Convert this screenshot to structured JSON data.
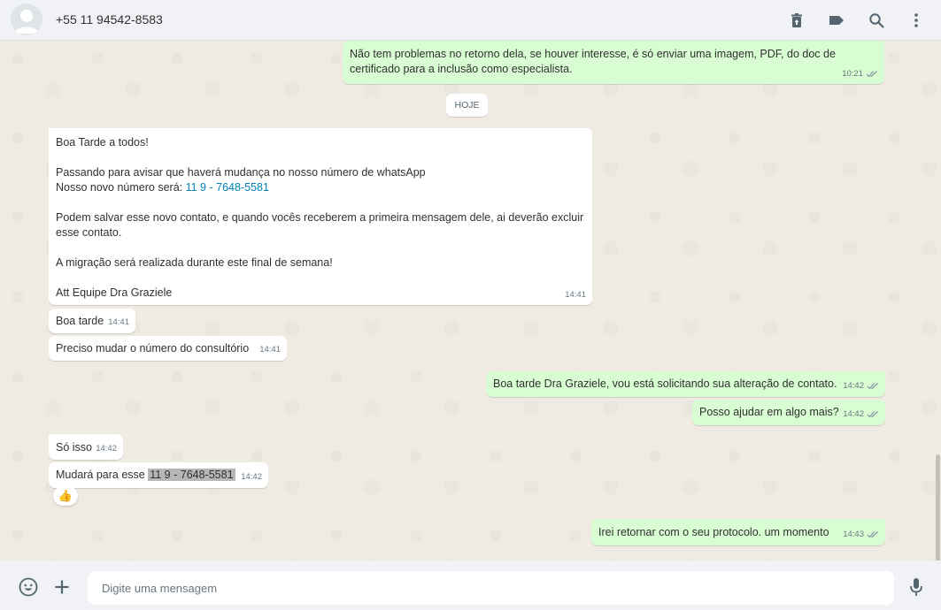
{
  "header": {
    "contact_name": "+55 11 94542-8583",
    "icons": [
      "delete-icon",
      "label-icon",
      "search-icon",
      "menu-icon"
    ]
  },
  "chat": {
    "date_divider": "HOJE",
    "messages": [
      {
        "direction": "out",
        "lines": [
          "Não tem problemas no retorno dela, se houver interesse, é só enviar uma imagem, PDF, do doc de",
          "certificado para a inclusão como especialista."
        ],
        "time": "10:21",
        "read": true
      },
      {
        "direction": "in",
        "greeting": "Boa Tarde a todos!",
        "line2": "Passando para avisar que haverá mudança no nosso número de whatsApp",
        "line3_prefix": "Nosso novo número será: ",
        "line3_link": "11 9 - 7648-5581",
        "line4": "Podem salvar esse novo contato, e quando vocês receberem a primeira mensagem dele, ai deverão excluir",
        "line5": "esse contato.",
        "line6": "A migração será realizada durante este final de semana!",
        "line7": "Att Equipe Dra Graziele",
        "time": "14:41"
      },
      {
        "direction": "in",
        "text": "Boa tarde",
        "time": "14:41"
      },
      {
        "direction": "in",
        "text": "Preciso mudar o número do consultório",
        "time": "14:41"
      },
      {
        "direction": "out",
        "text": "Boa tarde Dra Graziele, vou está solicitando sua alteração de contato.",
        "time": "14:42",
        "read": true
      },
      {
        "direction": "out",
        "text": "Posso ajudar em algo mais?",
        "time": "14:42",
        "read": true
      },
      {
        "direction": "in",
        "text": "Só isso",
        "time": "14:42"
      },
      {
        "direction": "in",
        "text_prefix": "Mudará para esse ",
        "highlight": "11 9 - 7648-5581",
        "time": "14:42",
        "reaction": "👍"
      },
      {
        "direction": "out",
        "text": "Irei retornar com o seu protocolo. um momento",
        "time": "14:43",
        "read": true
      }
    ]
  },
  "footer": {
    "placeholder": "Digite uma mensagem",
    "icons": [
      "emoji-icon",
      "attach-plus-icon",
      "microphone-icon"
    ]
  },
  "colors": {
    "outgoing_bubble": "#d9fdd3",
    "incoming_bubble": "#ffffff",
    "chat_background": "#efeae2",
    "header_background": "#f0f2f5",
    "link": "#027eb5",
    "read_ticks": "#53bdeb"
  }
}
